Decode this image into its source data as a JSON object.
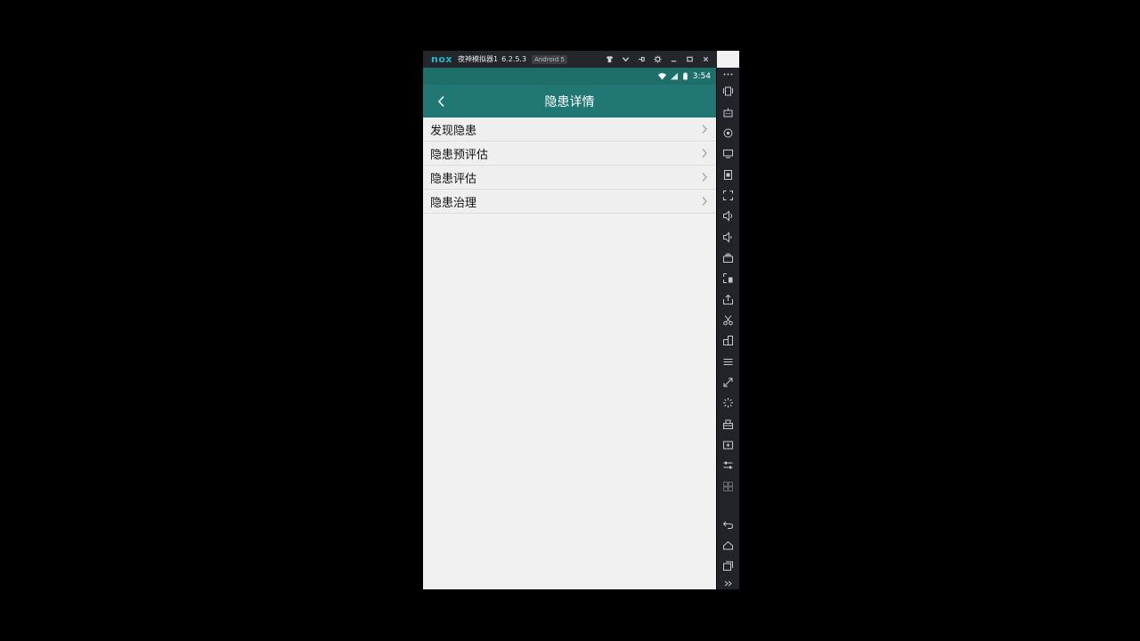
{
  "window": {
    "brand": "nox",
    "app_name": "夜神模拟器1",
    "version": "6.2.5.3",
    "android_badge": "Android 5",
    "controls": [
      "shirt-icon",
      "chevron-down-icon",
      "pin-icon",
      "gear-icon",
      "minimize-icon",
      "maximize-icon",
      "close-icon"
    ]
  },
  "statusbar": {
    "time": "3:54"
  },
  "appbar": {
    "title": "隐患详情"
  },
  "list": {
    "items": [
      {
        "label": "发现隐患"
      },
      {
        "label": "隐患预评估"
      },
      {
        "label": "隐患评估"
      },
      {
        "label": "隐患治理"
      }
    ]
  },
  "sidebar": {
    "tools": [
      "more",
      "shake",
      "robot",
      "location",
      "screen",
      "apk-install",
      "fullscreen",
      "volume-up",
      "volume-down",
      "multi-instance",
      "screenshot-record",
      "file-share",
      "cut",
      "multi-window",
      "menu",
      "resize",
      "loading",
      "toolbox",
      "add",
      "sliders",
      "disabled-grid"
    ],
    "nav": [
      "back",
      "home",
      "recent",
      "expand"
    ]
  },
  "colors": {
    "appbar": "#207773",
    "statusbar": "#1e6e6a",
    "background": "#efefef",
    "window_chrome": "#23262b",
    "brand": "#21b7c9"
  }
}
